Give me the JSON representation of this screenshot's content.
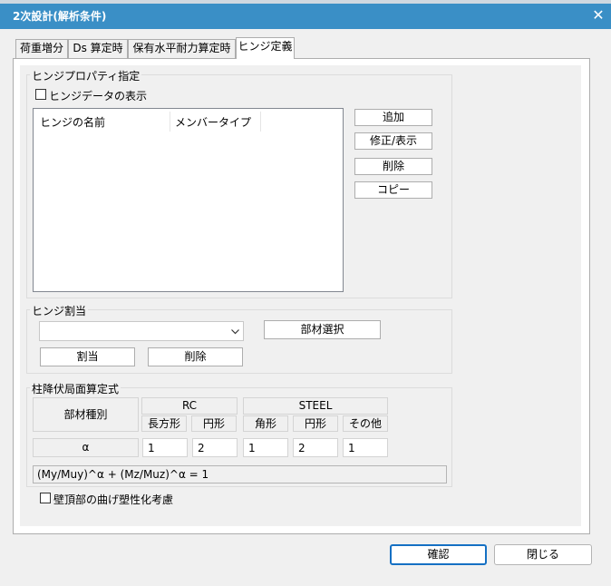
{
  "window": {
    "title": "2次設計(解析条件)",
    "close_glyph": "✕"
  },
  "tabs": [
    {
      "label": "荷重増分"
    },
    {
      "label": "Ds 算定時"
    },
    {
      "label": "保有水平耐力算定時"
    },
    {
      "label": "ヒンジ定義",
      "active": true
    }
  ],
  "hinge_property": {
    "group_label": "ヒンジプロパティ指定",
    "show_data_label": "ヒンジデータの表示",
    "show_data_checked": false,
    "columns": [
      "ヒンジの名前",
      "メンバータイプ"
    ],
    "rows": [],
    "buttons": {
      "add": "追加",
      "edit": "修正/表示",
      "delete": "削除",
      "copy": "コピー"
    }
  },
  "hinge_assign": {
    "group_label": "ヒンジ割当",
    "combo_value": "",
    "member_select": "部材選択",
    "assign": "割当",
    "delete": "削除"
  },
  "yield_surface": {
    "group_label": "柱降伏局面算定式",
    "member_type_label": "部材種別",
    "rc_label": "RC",
    "steel_label": "STEEL",
    "rc_cols": [
      "長方形",
      "円形"
    ],
    "steel_cols": [
      "角形",
      "円形",
      "その他"
    ],
    "alpha_label": "α",
    "values": [
      "1",
      "2",
      "1",
      "2",
      "1"
    ],
    "formula": "(My/Muy)^α + (Mz/Muz)^α = 1"
  },
  "wall_option": {
    "label": "壁頂部の曲げ塑性化考慮",
    "checked": false
  },
  "footer": {
    "ok": "確認",
    "close": "閉じる"
  }
}
